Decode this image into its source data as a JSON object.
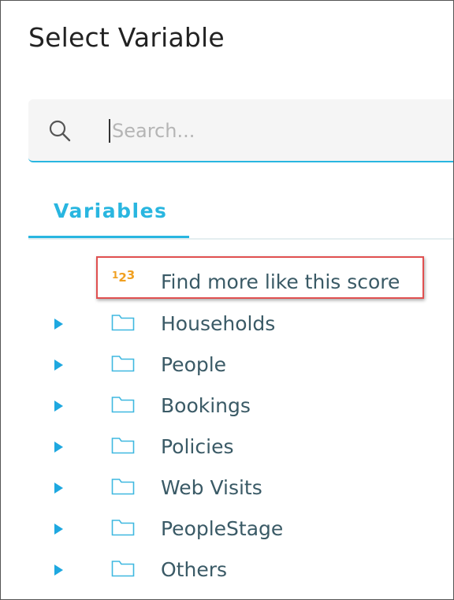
{
  "dialog": {
    "title": "Select Variable"
  },
  "search": {
    "placeholder": "Search...",
    "value": ""
  },
  "tabs": [
    {
      "label": "Variables",
      "active": true
    }
  ],
  "score_item": {
    "label": "Find more like this score",
    "icon": "numeric-123-icon",
    "icon_color": "#f0a020"
  },
  "folders": [
    {
      "label": "Households"
    },
    {
      "label": "People"
    },
    {
      "label": "Bookings"
    },
    {
      "label": "Policies"
    },
    {
      "label": "Web Visits"
    },
    {
      "label": "PeopleStage"
    },
    {
      "label": "Others"
    }
  ],
  "colors": {
    "accent": "#29b6e0",
    "text": "#3a5a66",
    "highlight_border": "#e05050"
  }
}
